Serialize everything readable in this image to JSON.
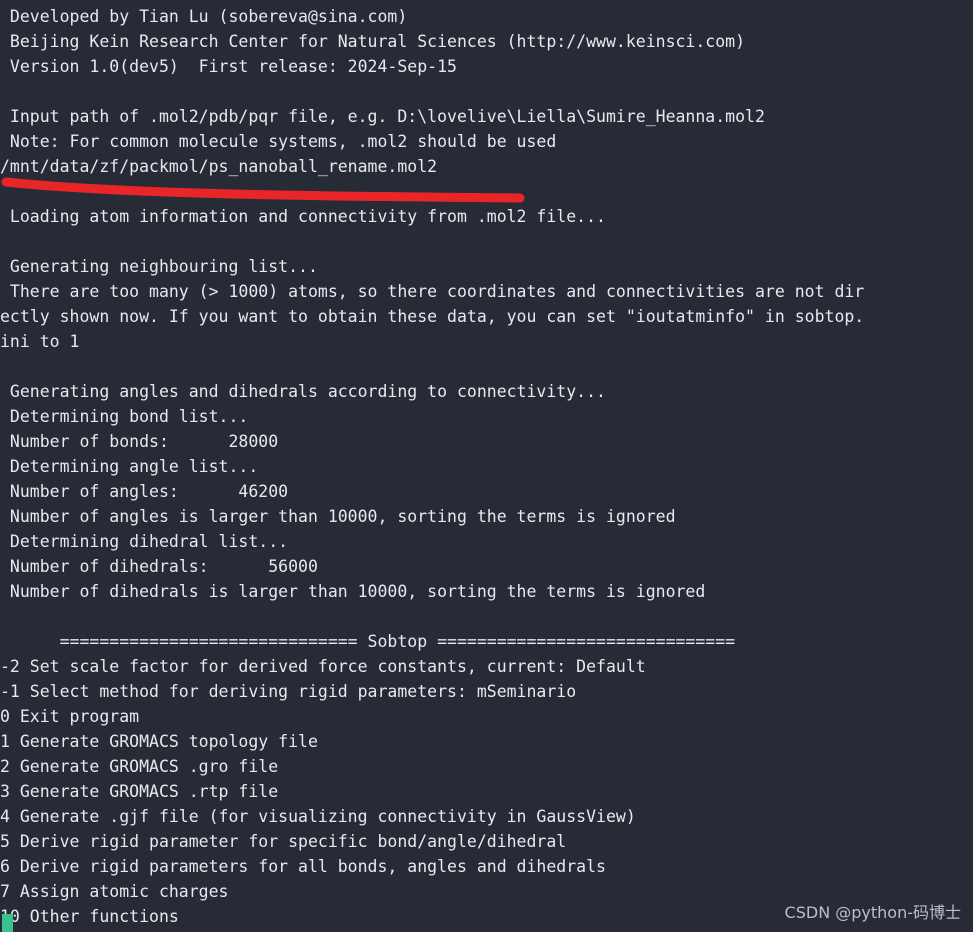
{
  "terminal": {
    "background_color": "#272b36",
    "text_color": "#e6e9ef",
    "lines": [
      " Developed by Tian Lu (sobereva@sina.com)",
      " Beijing Kein Research Center for Natural Sciences (http://www.keinsci.com)",
      " Version 1.0(dev5)  First release: 2024-Sep-15",
      "",
      " Input path of .mol2/pdb/pqr file, e.g. D:\\lovelive\\Liella\\Sumire_Heanna.mol2",
      " Note: For common molecule systems, .mol2 should be used",
      "/mnt/data/zf/packmol/ps_nanoball_rename.mol2",
      "",
      " Loading atom information and connectivity from .mol2 file...",
      "",
      " Generating neighbouring list...",
      " There are too many (> 1000) atoms, so there coordinates and connectivities are not dir",
      "ectly shown now. If you want to obtain these data, you can set \"ioutatminfo\" in sobtop.",
      "ini to 1",
      "",
      " Generating angles and dihedrals according to connectivity...",
      " Determining bond list...",
      " Number of bonds:      28000",
      " Determining angle list...",
      " Number of angles:      46200",
      " Number of angles is larger than 10000, sorting the terms is ignored",
      " Determining dihedral list...",
      " Number of dihedrals:      56000",
      " Number of dihedrals is larger than 10000, sorting the terms is ignored",
      "",
      "      ============================== Sobtop ==============================",
      "-2 Set scale factor for derived force constants, current: Default",
      "-1 Select method for deriving rigid parameters: mSeminario",
      "0 Exit program",
      "1 Generate GROMACS topology file",
      "2 Generate GROMACS .gro file",
      "3 Generate GROMACS .rtp file",
      "4 Generate .gjf file (for visualizing connectivity in GaussView)",
      "5 Derive rigid parameter for specific bond/angle/dihedral",
      "6 Derive rigid parameters for all bonds, angles and dihedrals",
      "7 Assign atomic charges",
      "10 Other functions"
    ]
  },
  "header": {
    "developer_line": " Developed by Tian Lu (sobereva@sina.com)",
    "institution_line": " Beijing Kein Research Center for Natural Sciences (http://www.keinsci.com)",
    "version_line": " Version 1.0(dev5)  First release: 2024-Sep-15",
    "version": "1.0(dev5)",
    "first_release": "2024-Sep-15",
    "email": "sobereva@sina.com",
    "website": "http://www.keinsci.com"
  },
  "input_prompt": {
    "instruction": " Input path of .mol2/pdb/pqr file, e.g. D:\\lovelive\\Liella\\Sumire_Heanna.mol2",
    "note": " Note: For common molecule systems, .mol2 should be used",
    "entered_path": "/mnt/data/zf/packmol/ps_nanoball_rename.mol2"
  },
  "status": {
    "loading": " Loading atom information and connectivity from .mol2 file...",
    "neighbour_list": " Generating neighbouring list...",
    "too_many_atoms_1": " There are too many (> 1000) atoms, so there coordinates and connectivities are not dir",
    "too_many_atoms_2": "ectly shown now. If you want to obtain these data, you can set \"ioutatminfo\" in sobtop.",
    "too_many_atoms_3": "ini to 1",
    "generating": " Generating angles and dihedrals according to connectivity...",
    "determining_bonds": " Determining bond list...",
    "number_of_bonds": " Number of bonds:      28000",
    "determining_angles": " Determining angle list...",
    "number_of_angles": " Number of angles:      46200",
    "angles_sort_ignored": " Number of angles is larger than 10000, sorting the terms is ignored",
    "determining_dihedrals": " Determining dihedral list...",
    "number_of_dihedrals": " Number of dihedrals:      56000",
    "dihedrals_sort_ignored": " Number of dihedrals is larger than 10000, sorting the terms is ignored",
    "counts": {
      "bonds": "28000",
      "angles": "46200",
      "dihedrals": "56000",
      "sort_threshold": "10000",
      "atom_threshold": "1000"
    }
  },
  "menu": {
    "banner": "      ============================== Sobtop ==============================",
    "title": "Sobtop",
    "items": [
      {
        "key": "-2",
        "label": "-2 Set scale factor for derived force constants, current: Default",
        "current": "Default"
      },
      {
        "key": "-1",
        "label": "-1 Select method for deriving rigid parameters: mSeminario",
        "current": "mSeminario"
      },
      {
        "key": "0",
        "label": "0 Exit program"
      },
      {
        "key": "1",
        "label": "1 Generate GROMACS topology file"
      },
      {
        "key": "2",
        "label": "2 Generate GROMACS .gro file"
      },
      {
        "key": "3",
        "label": "3 Generate GROMACS .rtp file"
      },
      {
        "key": "4",
        "label": "4 Generate .gjf file (for visualizing connectivity in GaussView)"
      },
      {
        "key": "5",
        "label": "5 Derive rigid parameter for specific bond/angle/dihedral"
      },
      {
        "key": "6",
        "label": "6 Derive rigid parameters for all bonds, angles and dihedrals"
      },
      {
        "key": "7",
        "label": "7 Assign atomic charges"
      },
      {
        "key": "10",
        "label": "10 Other functions"
      }
    ]
  },
  "annotation": {
    "type": "red-underline-stroke",
    "color": "#e8262a",
    "target": "/mnt/data/zf/packmol/ps_nanoball_rename.mol2"
  },
  "cursor": {
    "color": "#35c48c"
  },
  "watermark": {
    "text": "CSDN @python-码博士"
  }
}
